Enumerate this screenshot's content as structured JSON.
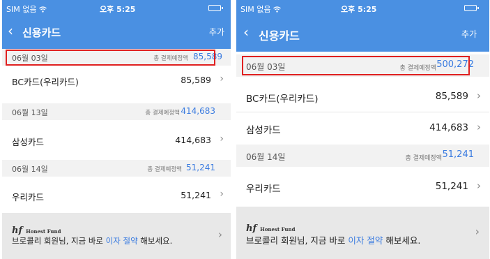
{
  "colors": {
    "header": "#4a90e2",
    "accent": "#3a7be0",
    "highlight_box": "#e02020"
  },
  "left": {
    "status": {
      "carrier": "SIM 없음",
      "time": "오후 5:25"
    },
    "nav": {
      "back_icon": "‹",
      "title": "신용카드",
      "add": "추가"
    },
    "groups": [
      {
        "date": "06월 03일",
        "total_label": "총 결제예정액",
        "total": "85,589",
        "cards": [
          {
            "name": "BC카드(우리카드)",
            "amount": "85,589"
          }
        ]
      },
      {
        "date": "06월 13일",
        "total_label": "총 결제예정액",
        "total": "414,683",
        "cards": [
          {
            "name": "삼성카드",
            "amount": "414,683"
          }
        ]
      },
      {
        "date": "06월 14일",
        "total_label": "총 결제예정액",
        "total": "51,241",
        "cards": [
          {
            "name": "우리카드",
            "amount": "51,241"
          }
        ]
      }
    ],
    "banner": {
      "brand_mark": "hf",
      "brand_name": "Honest Fund",
      "text_before": "브로콜리 회원님, 지금 바로 ",
      "text_highlight": "이자 절약",
      "text_after": " 해보세요."
    }
  },
  "right": {
    "status": {
      "carrier": "SIM 없음",
      "time": "오후 5:25"
    },
    "nav": {
      "back_icon": "‹",
      "title": "신용카드",
      "add": "추가"
    },
    "groups": [
      {
        "date": "06월 03일",
        "total_label": "총 결제예정액",
        "total": "500,272",
        "cards": [
          {
            "name": "BC카드(우리카드)",
            "amount": "85,589"
          },
          {
            "name": "삼성카드",
            "amount": "414,683"
          }
        ]
      },
      {
        "date": "06월 14일",
        "total_label": "총 결제예정액",
        "total": "51,241",
        "cards": [
          {
            "name": "우리카드",
            "amount": "51,241"
          }
        ]
      }
    ],
    "banner": {
      "brand_mark": "hf",
      "brand_name": "Honest Fund",
      "text_before": "브로콜리 회원님, 지금 바로 ",
      "text_highlight": "이자 절약",
      "text_after": " 해보세요."
    }
  },
  "chevron": "›"
}
